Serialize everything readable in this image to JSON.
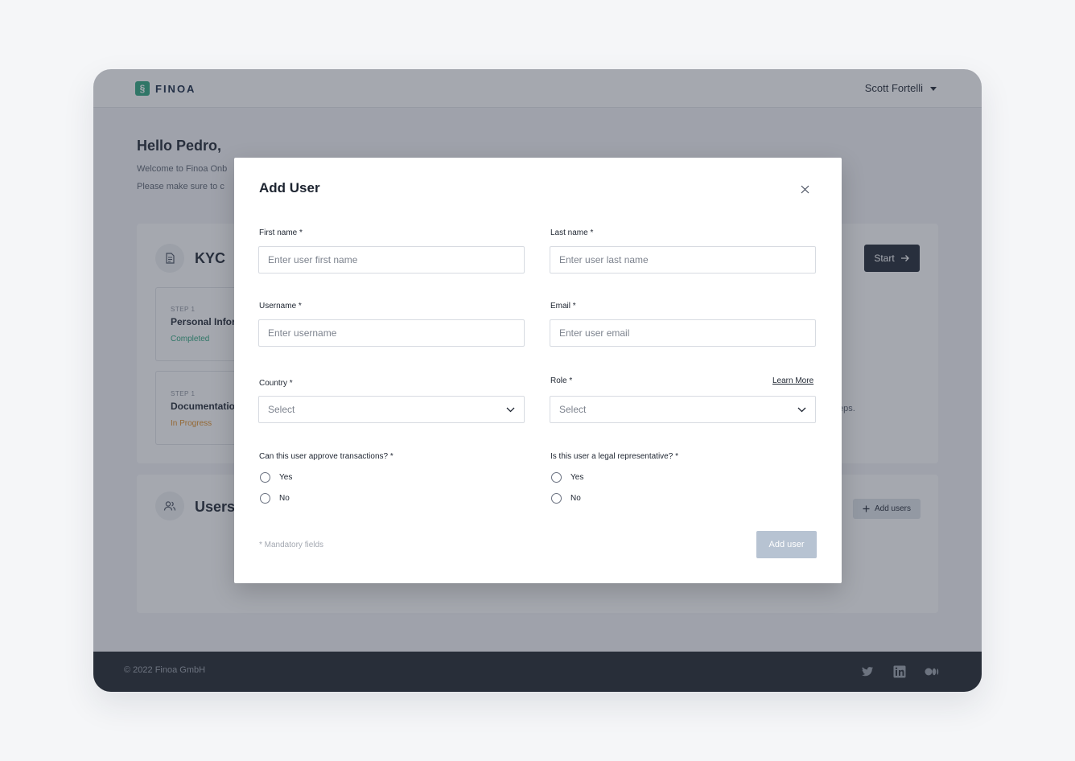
{
  "brand": {
    "name": "FINOA",
    "logo_icon": "finoa-mark-icon",
    "accent": "#2aa57c"
  },
  "header": {
    "user_name": "Scott Fortelli"
  },
  "main": {
    "greeting": "Hello Pedro,",
    "welcome_line1": "Welcome to Finoa Onb",
    "welcome_line2": "Please make sure to c"
  },
  "kyc": {
    "title": "KYC",
    "start_label": "Start",
    "steps": [
      {
        "kicker": "STEP 1",
        "name": "Personal Inforr",
        "status": "Completed",
        "status_color": "#2aa57c"
      },
      {
        "kicker": "STEP 1",
        "name": "Documentation",
        "status": "In Progress",
        "status_color": "#e08a1e"
      }
    ],
    "peek_text": "eps."
  },
  "users": {
    "title": "Users",
    "add_label": "Add users"
  },
  "footer": {
    "copyright": "© 2022 Finoa GmbH",
    "social_icons": [
      "twitter-icon",
      "linkedin-icon",
      "medium-icon"
    ]
  },
  "modal": {
    "title": "Add User",
    "first_name": {
      "label": "First name *",
      "placeholder": "Enter user first name",
      "value": ""
    },
    "last_name": {
      "label": "Last name *",
      "placeholder": "Enter user last name",
      "value": ""
    },
    "username": {
      "label": "Username *",
      "placeholder": "Enter username",
      "value": ""
    },
    "email": {
      "label": "Email *",
      "placeholder": "Enter user email",
      "value": ""
    },
    "country": {
      "label": "Country *",
      "value": "Select"
    },
    "role": {
      "label": "Role *",
      "value": "Select",
      "learn_more": "Learn More"
    },
    "approve": {
      "label": "Can this user approve transactions? *",
      "yes": "Yes",
      "no": "No"
    },
    "legal_rep": {
      "label": "Is this user a legal representative? *",
      "yes": "Yes",
      "no": "No"
    },
    "mandatory_note": "* Mandatory fields",
    "submit_label": "Add user",
    "submit_color": "#b7c3d2"
  }
}
